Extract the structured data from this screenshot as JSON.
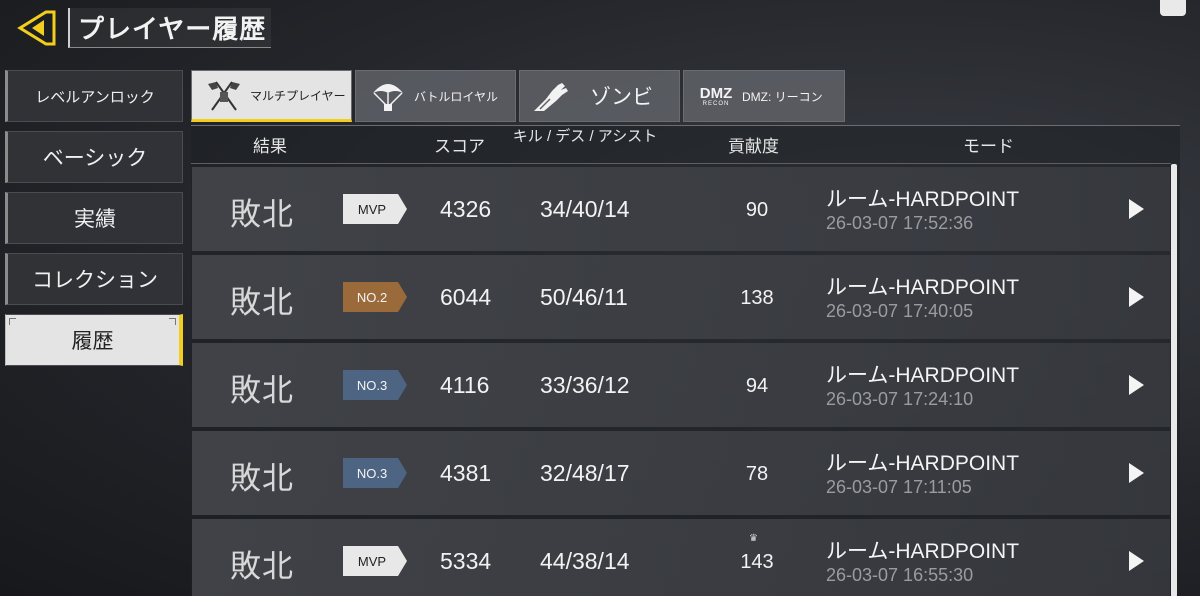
{
  "header": {
    "back_icon": "yellow-back-arrow-icon",
    "title": "プレイヤー履歴"
  },
  "sidebar": {
    "items": [
      {
        "label": "レベルアンロック",
        "active": false
      },
      {
        "label": "ベーシック",
        "active": false
      },
      {
        "label": "実績",
        "active": false
      },
      {
        "label": "コレクション",
        "active": false
      },
      {
        "label": "履歴",
        "active": true
      }
    ]
  },
  "tabs": [
    {
      "label": "マルチプレイヤー",
      "icon": "flags-icon",
      "active": true
    },
    {
      "label": "バトルロイヤル",
      "icon": "parachute-icon",
      "active": false
    },
    {
      "label": "ゾンビ",
      "icon": "zombie-hand-icon",
      "active": false
    },
    {
      "label": "DMZ: リーコン",
      "icon": "dmz-logo-icon",
      "logo_main": "DMZ",
      "logo_sub": "RECON",
      "active": false
    }
  ],
  "table": {
    "headers": {
      "result": "結果",
      "score": "スコア",
      "kda": "キル / デス / アシスト",
      "contribution": "貢献度",
      "mode": "モード"
    },
    "rows": [
      {
        "result": "敗北",
        "badge": "MVP",
        "score": "4326",
        "kda": "34/40/14",
        "contribution": "90",
        "mode": "ルーム-HARDPOINT",
        "time": "26-03-07 17:52:36"
      },
      {
        "result": "敗北",
        "badge": "NO.2",
        "score": "6044",
        "kda": "50/46/11",
        "contribution": "138",
        "mode": "ルーム-HARDPOINT",
        "time": "26-03-07 17:40:05"
      },
      {
        "result": "敗北",
        "badge": "NO.3",
        "score": "4116",
        "kda": "33/36/12",
        "contribution": "94",
        "mode": "ルーム-HARDPOINT",
        "time": "26-03-07 17:24:10"
      },
      {
        "result": "敗北",
        "badge": "NO.3",
        "score": "4381",
        "kda": "32/48/17",
        "contribution": "78",
        "mode": "ルーム-HARDPOINT",
        "time": "26-03-07 17:11:05"
      },
      {
        "result": "敗北",
        "badge": "MVP",
        "score": "5334",
        "kda": "44/38/14",
        "contribution": "143",
        "crown": "♛",
        "mode": "ルーム-HARDPOINT",
        "time": "26-03-07 16:55:30"
      }
    ]
  },
  "colors": {
    "accent": "#f2cf1c",
    "badge_mvp_bg": "#e8e8e8",
    "badge_mvp_text": "#222222",
    "badge_no2_bg": "#9a6a3a",
    "badge_no3_bg": "#4d6482"
  }
}
